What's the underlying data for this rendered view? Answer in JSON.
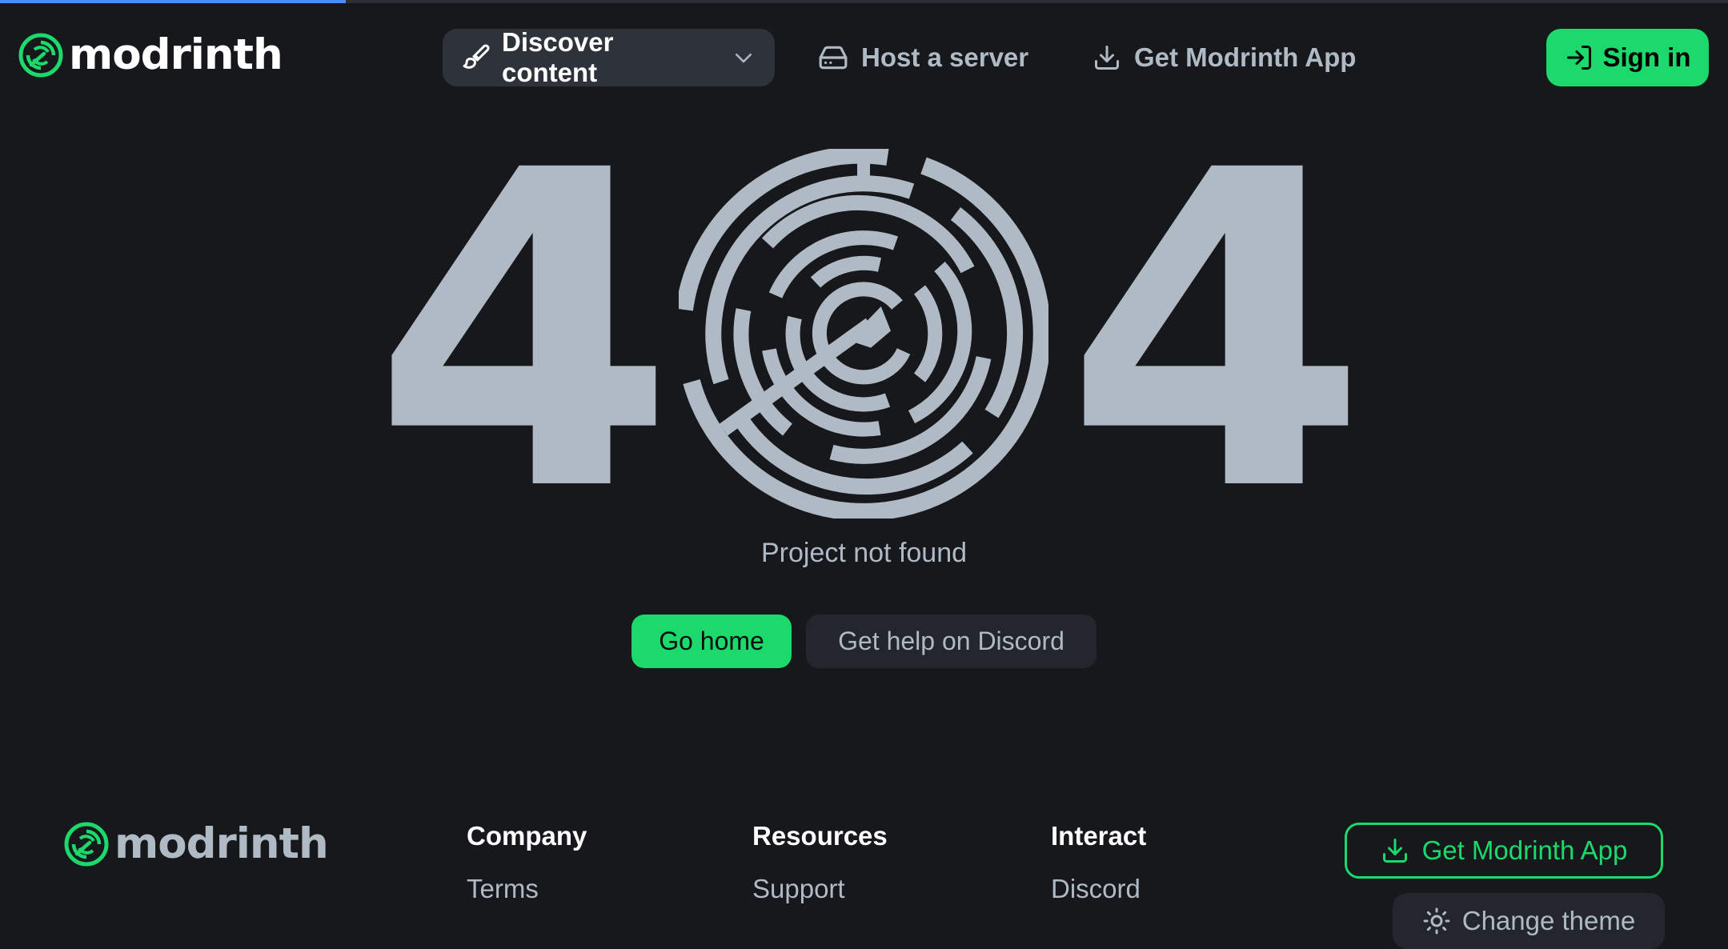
{
  "page_load_progress": 0.2,
  "brand": {
    "name": "modrinth",
    "accent": "#1bd96a",
    "background": "#16181c",
    "text": "#b0bac5"
  },
  "header": {
    "nav": {
      "discover": {
        "label": "Discover content",
        "icon": "paintbrush-icon",
        "trailing_icon": "chevron-down-icon"
      },
      "host": {
        "label": "Host a server",
        "icon": "server-icon"
      },
      "app": {
        "label": "Get Modrinth App",
        "icon": "download-icon"
      }
    },
    "sign_in": {
      "label": "Sign in",
      "icon": "sign-in-icon"
    }
  },
  "error": {
    "code_digits": [
      "4",
      "4"
    ],
    "zero_icon": "maze-icon",
    "message": "Project not found",
    "buttons": {
      "home": "Go home",
      "discord": "Get help on Discord"
    }
  },
  "footer": {
    "columns": [
      {
        "title": "Company",
        "links": [
          "Terms"
        ]
      },
      {
        "title": "Resources",
        "links": [
          "Support"
        ]
      },
      {
        "title": "Interact",
        "links": [
          "Discord"
        ]
      }
    ],
    "get_app": {
      "label": "Get Modrinth App",
      "icon": "download-icon"
    },
    "theme": {
      "label": "Change theme",
      "icon": "sun-icon"
    }
  }
}
